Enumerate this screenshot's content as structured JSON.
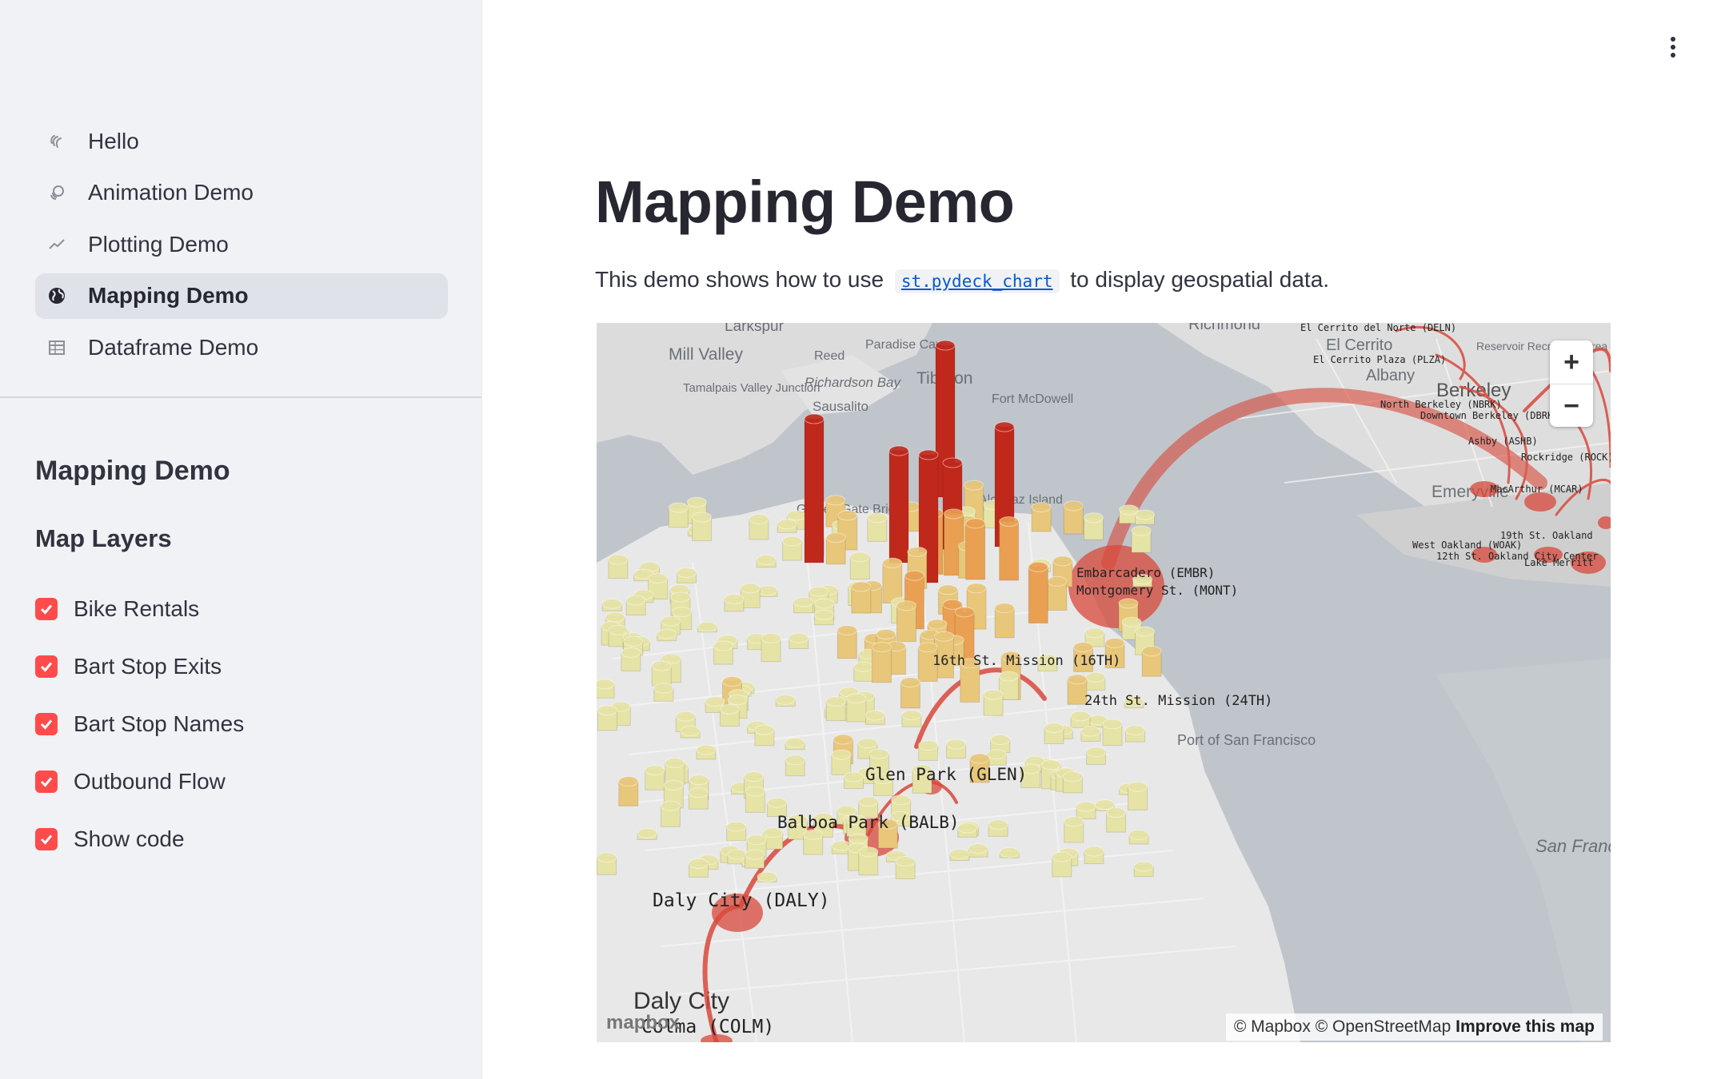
{
  "sidebar": {
    "nav": [
      {
        "label": "Hello",
        "icon": "wave-icon"
      },
      {
        "label": "Animation Demo",
        "icon": "animation-icon"
      },
      {
        "label": "Plotting Demo",
        "icon": "chart-line-icon"
      },
      {
        "label": "Mapping Demo",
        "icon": "globe-icon",
        "active": true
      },
      {
        "label": "Dataframe Demo",
        "icon": "table-icon"
      }
    ],
    "title": "Mapping Demo",
    "section": "Map Layers",
    "layers": [
      {
        "label": "Bike Rentals",
        "checked": true
      },
      {
        "label": "Bart Stop Exits",
        "checked": true
      },
      {
        "label": "Bart Stop Names",
        "checked": true
      },
      {
        "label": "Outbound Flow",
        "checked": true
      },
      {
        "label": "Show code",
        "checked": true
      }
    ]
  },
  "main": {
    "title": "Mapping Demo",
    "desc_before": "This demo shows how to use",
    "code": "st.pydeck_chart",
    "desc_after": "to display geospatial data."
  },
  "map": {
    "zoom_in": "+",
    "zoom_out": "−",
    "attribution": "© Mapbox © OpenStreetMap",
    "improve": "Improve this map",
    "logo": "mapbox",
    "places": [
      "Larkspur",
      "Mill Valley",
      "Reed",
      "Paradise Cay",
      "Tiburon",
      "Tamalpais Valley Junction",
      "Richardson Bay",
      "Sausalito",
      "Fort McDowell",
      "Golden Gate Bridge",
      "Alcatraz Island",
      "Richmond",
      "El Cerrito",
      "Albany",
      "Berkeley",
      "Emeryville",
      "Reservoir Recreation Area",
      "Port of San Francisco",
      "San Francisco Bay",
      "Daly City"
    ],
    "stops": [
      "Glen Park (GLEN)",
      "Balboa Park (BALB)",
      "Daly City (DALY)",
      "Colma (COLM)",
      "El Cerrito del Norte (DELN)",
      "El Cerrito Plaza (PLZA)",
      "North Berkeley (NBRK)",
      "Downtown Berkeley (DBRK)",
      "Ashby (ASHB)",
      "Rockridge (ROCK)",
      "MacArthur (MCAR)",
      "West Oakland (WOAK)",
      "12th St. Oakland City Center",
      "19th St. Oakland",
      "Lake Merritt",
      "Embarcadero (EMBR)",
      "Montgomery St. (MONT)",
      "24th St. Mission (24TH)",
      "16th St. Mission (16TH)"
    ],
    "colors": {
      "flow": "#d9483b",
      "low": "#e6e3a6",
      "mid": "#e9a052",
      "high": "#c0281c"
    }
  }
}
